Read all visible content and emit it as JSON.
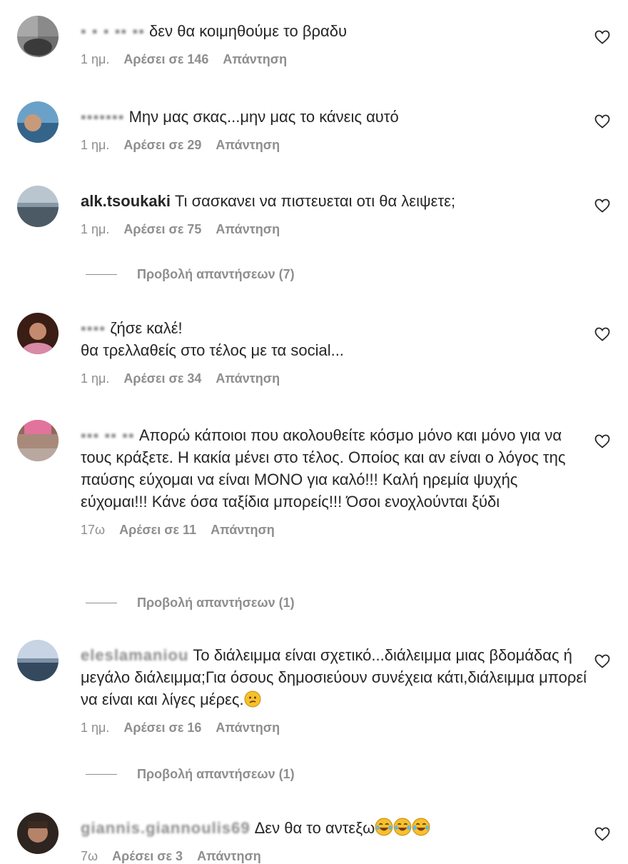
{
  "comments": [
    {
      "username": "▪ ▪ ▪ ▪▪ ▪▪",
      "text": "δεν θα κοιμηθούμε το βραδυ",
      "time": "1 ημ.",
      "likes": "Αρέσει σε 146",
      "reply": "Απάντηση",
      "avatar_colors": [
        "#6e6e6e",
        "#3a3a3a"
      ]
    },
    {
      "username": "▪▪▪▪▪▪▪",
      "text": "Μην μας σκας...μην μας το κάνεις αυτό",
      "time": "1 ημ.",
      "likes": "Αρέσει σε 29",
      "reply": "Απάντηση",
      "avatar_colors": [
        "#6aa1c9",
        "#35648a"
      ]
    },
    {
      "username": "alk.tsoukaki",
      "text": "Τι σασκανει να πιστευεται οτι θα λειψετε;",
      "time": "1 ημ.",
      "likes": "Αρέσει σε 75",
      "reply": "Απάντηση",
      "avatar_colors": [
        "#b9c6d0",
        "#4c5a66"
      ]
    },
    {
      "username": "▪▪▪▪",
      "text": "ζήσε καλέ!\nθα τρελλαθείς στο τέλος με τα social...",
      "time": "1 ημ.",
      "likes": "Αρέσει σε 34",
      "reply": "Απάντηση",
      "avatar_colors": [
        "#3a1d14",
        "#d98aa6"
      ]
    },
    {
      "username": "▪▪▪ ▪▪ ▪▪",
      "text": "Απορώ κάποιοι που ακολουθείτε κόσμο μόνο και μόνο για να τους κράξετε. Η κακία μένει στο τέλος. Οποίος και αν είναι ο λόγος της παύσης εύχομαι να είναι ΜΟΝΟ για καλό!!! Καλή ηρεμία ψυχής εύχομαι!!! Κάνε όσα ταξίδια μπορείς!!! Όσοι ενοχλούνται ξύδι",
      "time": "17ω",
      "likes": "Αρέσει σε 11",
      "reply": "Απάντηση",
      "avatar_colors": [
        "#e2739d",
        "#8c6b5b"
      ]
    },
    {
      "username": "eleslamaniou",
      "text": "Το διάλειμμα είναι σχετικό...διάλειμμα μιας βδομάδας ή μεγάλο διάλειμμα;Για όσους δημοσιεύουν συνέχεια κάτι,διάλειμμα μπορεί να είναι και λίγες μέρες.",
      "time": "1 ημ.",
      "likes": "Αρέσει σε 16",
      "reply": "Απάντηση",
      "avatar_colors": [
        "#c8d4e4",
        "#34495e"
      ]
    },
    {
      "username": "giannis.giannoulis69",
      "text": "Δεν θα το αντεξω",
      "time": "7ω",
      "likes": "Αρέσει σε 3",
      "reply": "Απάντηση",
      "avatar_colors": [
        "#7a5a4a",
        "#2e2420"
      ]
    }
  ],
  "replies_links": [
    {
      "label": "Προβολή απαντήσεων (7)"
    },
    {
      "label": "Προβολή απαντήσεων (1)"
    },
    {
      "label": "Προβολή απαντήσεων (1)"
    }
  ],
  "icons": {
    "like": "heart-outline-icon",
    "emoji": "face-with-tears-of-joy / confused-face"
  }
}
